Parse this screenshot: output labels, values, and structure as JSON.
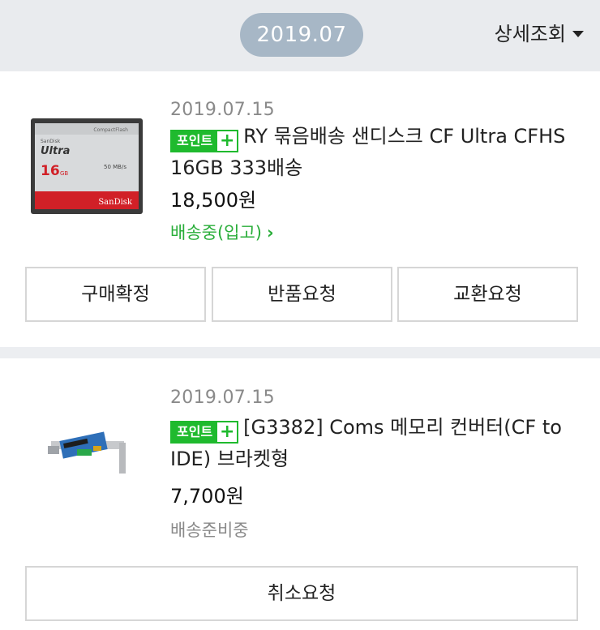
{
  "header": {
    "month": "2019.07",
    "detail_label": "상세조회"
  },
  "badge": {
    "label": "포인트",
    "plus": "+",
    "color": "#1fba2e"
  },
  "orders": [
    {
      "date": "2019.07.15",
      "title": "RY 묶음배송 샌디스크 CF Ultra CFHS 16GB 333배송",
      "price": "18,500원",
      "status": "배송중(입고)",
      "status_color": "#2aae3a",
      "product_image": {
        "brand_top": "CompactFlash",
        "brand_small": "SanDisk",
        "model": "Ultra",
        "capacity": "16",
        "unit": "GB",
        "speed": "50 MB/s",
        "brand": "SanDisk"
      },
      "actions": [
        "구매확정",
        "반품요청",
        "교환요청"
      ]
    },
    {
      "date": "2019.07.15",
      "title": "[G3382] Coms 메모리 컨버터(CF to IDE) 브라켓형",
      "price": "7,700원",
      "status": "배송준비중",
      "status_color": "#8a8a8a",
      "actions": [
        "취소요청"
      ]
    }
  ]
}
